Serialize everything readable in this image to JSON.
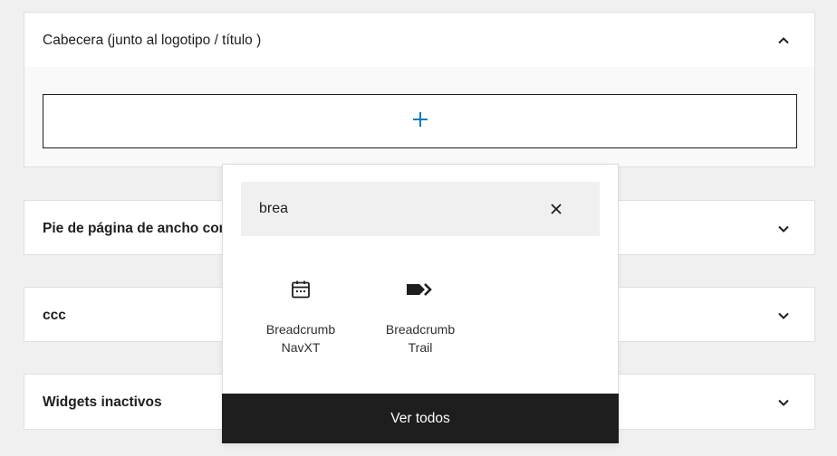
{
  "panels": [
    {
      "title": "Cabecera (junto al logotipo / título )",
      "expanded": true
    },
    {
      "title": "Pie de página de ancho completo",
      "expanded": false
    },
    {
      "title": "ccc",
      "expanded": false
    },
    {
      "title": "Widgets inactivos",
      "expanded": false
    }
  ],
  "appender": {
    "icon": "plus-icon"
  },
  "inserter": {
    "search_value": "brea",
    "clear_icon": "close-icon",
    "results": [
      {
        "label": "Breadcrumb NavXT",
        "icon": "calendar-icon"
      },
      {
        "label": "Breadcrumb Trail",
        "icon": "tag-arrow-icon"
      }
    ],
    "browse_all_label": "Ver todos"
  },
  "colors": {
    "accent": "#007cba",
    "dark": "#1e1e1e",
    "background": "#f0f0f1"
  }
}
